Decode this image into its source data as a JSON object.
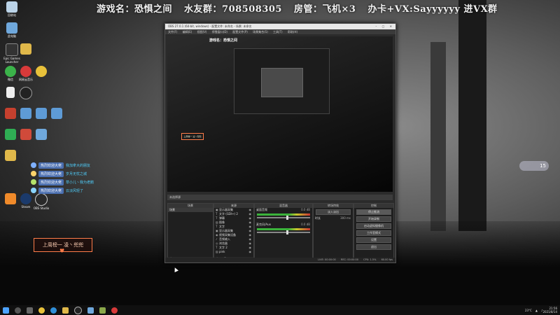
{
  "banner": {
    "game": "游戏名：恐惧之间",
    "fan_group": "水友群：708508305",
    "room_admin": "房管：飞机×3",
    "contact": "办卡+VX:Sayyyyyy 进VX群"
  },
  "desktop_icons": [
    {
      "id": "recycle",
      "label": "回收站",
      "color": "#bcd4e8"
    },
    {
      "id": "computer",
      "label": "此电脑",
      "color": "#6fa8dc"
    },
    {
      "id": "epic",
      "label": "Epic Games Launcher",
      "color": "#333333"
    },
    {
      "id": "folder1",
      "label": "",
      "color": "#e0b84a"
    },
    {
      "id": "wechat",
      "label": "微信",
      "color": "#3bb34a"
    },
    {
      "id": "netease",
      "label": "网易云音乐",
      "color": "#d83a3a"
    },
    {
      "id": "chrome",
      "label": "",
      "color": "#e8c13a"
    },
    {
      "id": "doc1",
      "label": "",
      "color": "#eeeeee"
    },
    {
      "id": "obs1",
      "label": "",
      "color": "#222222"
    },
    {
      "id": "app1",
      "label": "",
      "color": "#c6402e"
    },
    {
      "id": "img1",
      "label": "",
      "color": "#5e9bd6"
    },
    {
      "id": "img2",
      "label": "",
      "color": "#5e9bd6"
    },
    {
      "id": "img3",
      "label": "",
      "color": "#5e9bd6"
    },
    {
      "id": "play",
      "label": "",
      "color": "#2fae54"
    },
    {
      "id": "wps",
      "label": "",
      "color": "#d04a3a"
    },
    {
      "id": "doc2",
      "label": "",
      "color": "#6fa8dc"
    },
    {
      "id": "folder2",
      "label": "",
      "color": "#e0b84a"
    },
    {
      "id": "app2",
      "label": "",
      "color": "#f08a2a"
    },
    {
      "id": "steam",
      "label": "Steam",
      "color": "#1b3a6b"
    },
    {
      "id": "obs",
      "label": "OBS Studio",
      "color": "#2a2a2a"
    }
  ],
  "chat": [
    {
      "tag": "热烈欢迎大佬",
      "user": "我加拿大的朋友",
      "color": "#7fb0ff"
    },
    {
      "tag": "热烈欢迎大佬",
      "user": "岁月无忧之城",
      "color": "#ffd36b"
    },
    {
      "tag": "热烈欢迎大佬",
      "user": "草小儿丶我为老鹅",
      "color": "#b5e36b"
    },
    {
      "tag": "热烈欢迎大佬",
      "user": "云淡风轻了",
      "color": "#8ad4ff"
    }
  ],
  "gift_box": "上周榜一 凌丶兜兜",
  "bubble_count": "15",
  "obs": {
    "title": "OBS 27.0.1 (64-bit, windows) - 配置文件: 未命名 - 场景: 未命名",
    "menu": [
      "文件(F)",
      "编辑(E)",
      "视图(V)",
      "停靠窗口(D)",
      "配置文件(P)",
      "场景集合(S)",
      "工具(T)",
      "帮助(H)"
    ],
    "dock_head": "未选择源",
    "scenes_title": "场景",
    "scenes": [
      "场景"
    ],
    "sources_title": "来源",
    "sources": [
      {
        "name": "显示器采集",
        "icon": "▣"
      },
      {
        "name": "文字 (GDI+) 2",
        "icon": "T"
      },
      {
        "name": "弹幕",
        "icon": "T"
      },
      {
        "name": "图像",
        "icon": "▨"
      },
      {
        "name": "文字",
        "icon": "T"
      },
      {
        "name": "显示器采集",
        "icon": "▣"
      },
      {
        "name": "视频采集设备",
        "icon": "◉"
      },
      {
        "name": "音频输入",
        "icon": "♪"
      },
      {
        "name": "浏览器",
        "icon": "◎"
      },
      {
        "name": "文字 2",
        "icon": "T"
      },
      {
        "name": "pink",
        "icon": "▨"
      },
      {
        "name": "窗口采集",
        "icon": "▢"
      }
    ],
    "mixer_title": "混音器",
    "mixer": [
      {
        "name": "桌面音频",
        "db": "0.0 dB"
      },
      {
        "name": "麦克风/Aux",
        "db": "0.0 dB"
      }
    ],
    "transitions_title": "转场特效",
    "transition_value": "淡入淡出",
    "duration_label": "时长",
    "duration_value": "300 ms",
    "controls_title": "控制",
    "controls": [
      "停止推流",
      "开始录制",
      "启动虚拟摄像机",
      "工作室模式",
      "设置",
      "退出"
    ],
    "status": [
      "LIVE: 00:00:00",
      "REC: 00:00:00",
      "CPU: 1.5%",
      "60.00 fps"
    ]
  },
  "tray": {
    "weather": "23°C",
    "time": "21:56",
    "date": "2021/8/14"
  }
}
